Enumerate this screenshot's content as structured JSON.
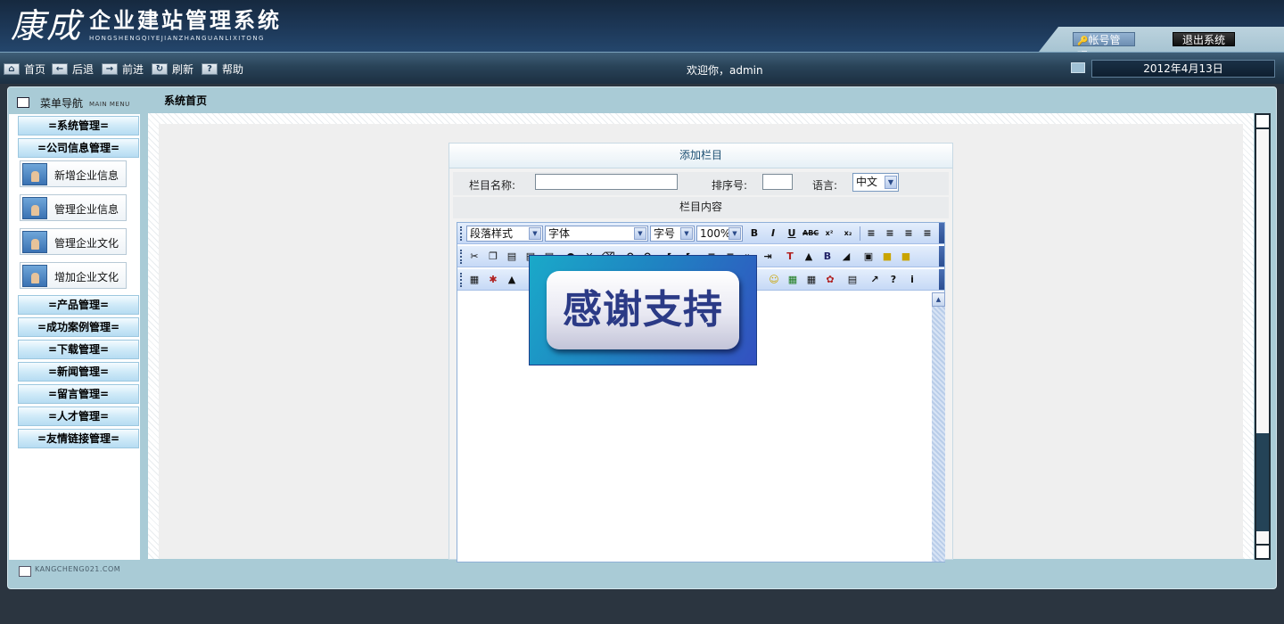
{
  "header": {
    "brand": "康成",
    "title": "企业建站管理系统",
    "pinyin": "HONGSHENGQIYEJIANZHANGUANLIXITONG",
    "account_label": "帐号管理",
    "logout_label": "退出系统"
  },
  "navbar": {
    "items": [
      {
        "label": "首页",
        "icon": "home-icon"
      },
      {
        "label": "后退",
        "icon": "back-arrow-icon"
      },
      {
        "label": "前进",
        "icon": "forward-arrow-icon"
      },
      {
        "label": "刷新",
        "icon": "refresh-icon"
      },
      {
        "label": "帮助",
        "icon": "help-icon"
      }
    ],
    "welcome": "欢迎你，admin",
    "date": "2012年4月13日"
  },
  "sidebar": {
    "title": "菜单导航",
    "subtitle": "MAIN MENU",
    "menus": [
      {
        "label": "=系统管理="
      },
      {
        "label": "=公司信息管理=",
        "expanded": true
      },
      {
        "label": "=产品管理="
      },
      {
        "label": "=成功案例管理="
      },
      {
        "label": "=下载管理="
      },
      {
        "label": "=新闻管理="
      },
      {
        "label": "=留言管理="
      },
      {
        "label": "=人才管理="
      },
      {
        "label": "=友情链接管理="
      }
    ],
    "sub_items": [
      {
        "label": "新增企业信息"
      },
      {
        "label": "管理企业信息"
      },
      {
        "label": "管理企业文化"
      },
      {
        "label": "增加企业文化"
      }
    ]
  },
  "breadcrumb": "系统首页",
  "form": {
    "title": "添加栏目",
    "name_label": "栏目名称:",
    "name_value": "",
    "order_label": "排序号:",
    "order_value": "",
    "language_label": "语言:",
    "language_value": "中文",
    "content_label": "栏目内容"
  },
  "editor": {
    "paragraph_style": "段落样式",
    "font": "字体",
    "font_size": "字号",
    "zoom": "100%"
  },
  "banner": {
    "text": "感谢支持"
  },
  "footer": {
    "text": "KANGCHENG021.COM"
  },
  "colors": {
    "header_bg": "#1d3858",
    "frame_bg": "#a9cbd6",
    "menu_head": "#cfeaf8",
    "form_title": "#1c4f72"
  }
}
